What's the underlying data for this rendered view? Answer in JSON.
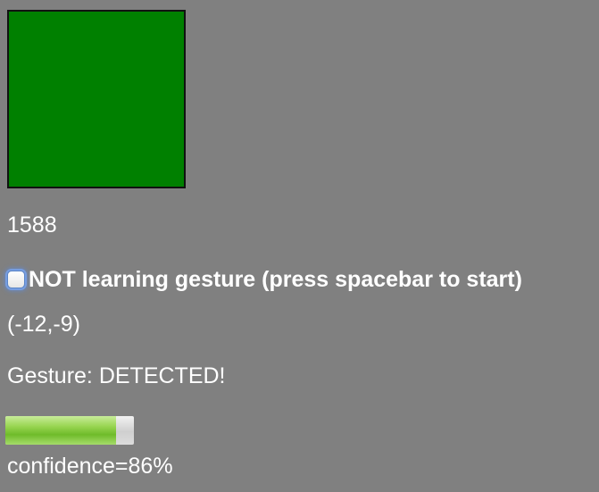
{
  "swatch": {
    "color": "#008000"
  },
  "counter": {
    "value": "1588"
  },
  "learning": {
    "checked": false,
    "label": "NOT learning gesture (press spacebar to start)"
  },
  "coords": {
    "text": "(-12,-9)"
  },
  "gesture": {
    "status": "Gesture: DETECTED!"
  },
  "confidence": {
    "fraction": 0.86,
    "label": "confidence=86%"
  }
}
